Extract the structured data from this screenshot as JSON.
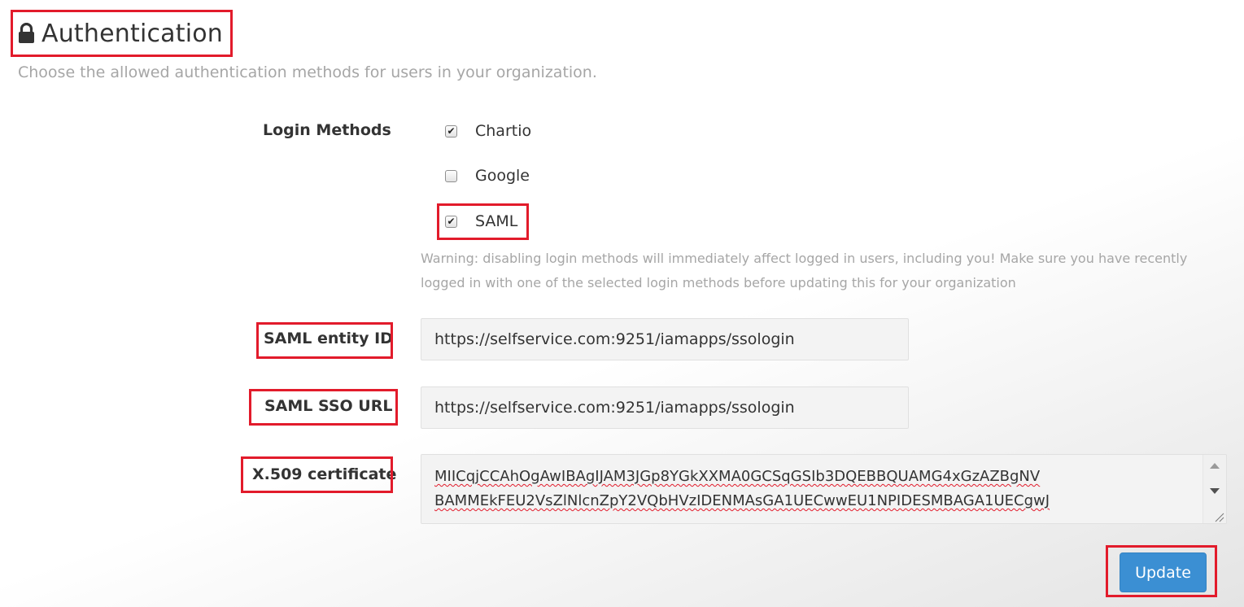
{
  "header": {
    "title": "Authentication",
    "subtitle": "Choose the allowed authentication methods for users in your organization."
  },
  "login_methods": {
    "label": "Login Methods",
    "options": [
      {
        "label": "Chartio",
        "checked": true
      },
      {
        "label": "Google",
        "checked": false
      },
      {
        "label": "SAML",
        "checked": true
      }
    ],
    "warning_line1": "Warning: disabling login methods will immediately affect logged in users, including you! Make sure you have recently",
    "warning_line2": "logged in with one of the selected login methods before updating this for your organization"
  },
  "saml_entity_id": {
    "label": "SAML entity ID",
    "value": "https://selfservice.com:9251/iamapps/ssologin"
  },
  "saml_sso_url": {
    "label": "SAML SSO URL",
    "value": "https://selfservice.com:9251/iamapps/ssologin"
  },
  "certificate": {
    "label": "X.509 certificate",
    "line1": "MIICqjCCAhOgAwIBAgIJAM3JGp8YGkXXMA0GCSqGSIb3DQEBBQUAMG4xGzAZBgNV",
    "line2": "BAMMEkFEU2VsZlNlcnZpY2VQbHVzIDENMAsGA1UECwwEU1NPIDESMBAGA1UECgwJ"
  },
  "actions": {
    "update_label": "Update"
  },
  "icons": {
    "title_icon": "lock-icon",
    "checked_glyph": "✔"
  },
  "colors": {
    "highlight": "#e21b2b",
    "primary_button": "#3b8fd3",
    "muted_text": "#a6a6a6"
  }
}
